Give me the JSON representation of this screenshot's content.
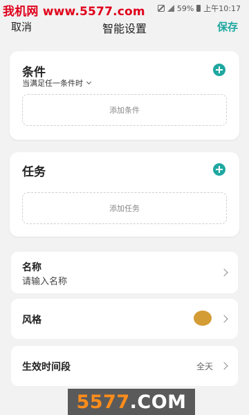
{
  "status_bar": {
    "watermark": "我机网 www.5577.com",
    "battery": "59%",
    "time": "上午10:17",
    "icons": [
      "mute-icon",
      "signal-icon",
      "battery-icon"
    ]
  },
  "nav": {
    "cancel_label": "取消",
    "title": "智能设置",
    "save_label": "保存"
  },
  "condition_card": {
    "title": "条件",
    "subtitle": "当满足任一条件时",
    "add_label": "添加条件"
  },
  "task_card": {
    "title": "任务",
    "add_label": "添加任务"
  },
  "rows": {
    "name": {
      "label": "名称",
      "placeholder": "请输入名称"
    },
    "style": {
      "label": "风格",
      "color": "#d49c35"
    },
    "time": {
      "label": "生效时间段",
      "value": "全天"
    }
  },
  "bottom_watermark": {
    "part1": "5577",
    "part2": ".COM"
  },
  "colors": {
    "accent": "#1fa7a1",
    "background": "#f2f2f2",
    "style_swatch": "#d49c35"
  }
}
